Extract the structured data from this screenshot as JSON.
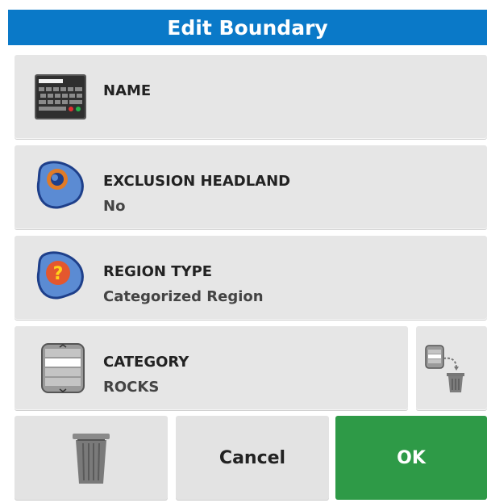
{
  "dialog": {
    "title": "Edit Boundary"
  },
  "fields": {
    "name": {
      "label": "NAME",
      "icon": "keyboard-icon"
    },
    "exclusion_headland": {
      "label": "EXCLUSION HEADLAND",
      "value": "No",
      "icon": "exclusion-headland-icon"
    },
    "region_type": {
      "label": "REGION TYPE",
      "value": "Categorized Region",
      "icon": "region-type-icon"
    },
    "category": {
      "label": "CATEGORY",
      "value": "ROCKS",
      "icon": "category-list-icon"
    }
  },
  "category_delete": {
    "icon": "delete-category-icon"
  },
  "actions": {
    "delete": {
      "icon": "trash-icon"
    },
    "cancel_label": "Cancel",
    "ok_label": "OK"
  },
  "colors": {
    "title_bar": "#0a79c8",
    "button_gray": "#e6e6e6",
    "ok_green": "#2e9a47"
  }
}
